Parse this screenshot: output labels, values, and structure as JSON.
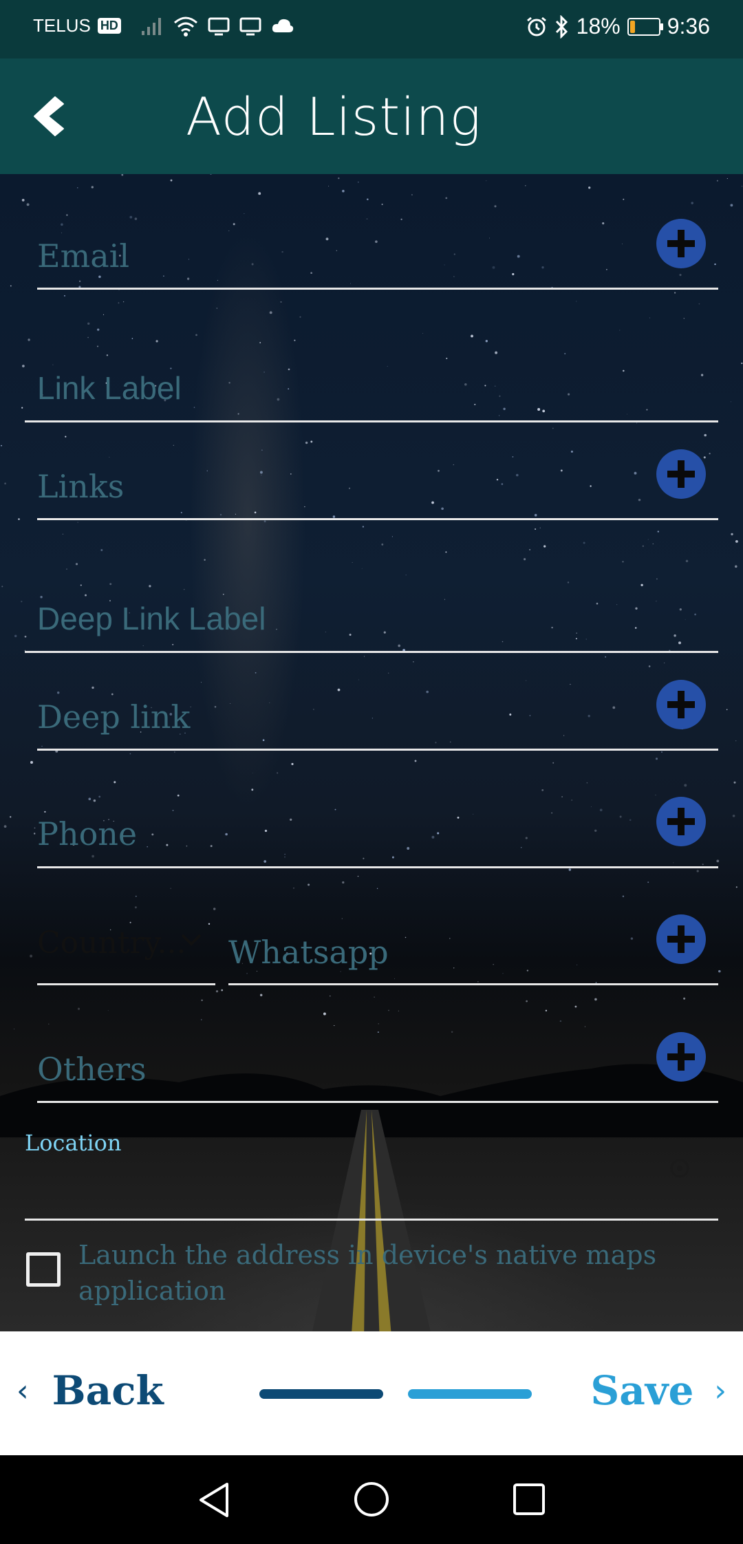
{
  "status_bar": {
    "carrier": "TELUS",
    "hd_badge": "HD",
    "battery_percent": "18%",
    "battery_level": 0.18,
    "time": "9:36",
    "icons": [
      "signal-icon",
      "wifi-icon",
      "cast-icon",
      "cast-icon",
      "cloud-icon",
      "alarm-icon",
      "bluetooth-icon",
      "battery-icon"
    ]
  },
  "header": {
    "title": "Add Listing",
    "back_icon": "chevron-left-icon"
  },
  "form": {
    "email_placeholder": "Email",
    "link_label_placeholder": "Link Label",
    "links_placeholder": "Links",
    "deep_link_label_placeholder": "Deep Link Label",
    "deep_link_placeholder": "Deep link",
    "phone_placeholder": "Phone",
    "country_placeholder": "Country...",
    "whatsapp_placeholder": "Whatsapp",
    "others_placeholder": "Others",
    "location_label": "Location",
    "location_value": "",
    "launch_maps_label": "Launch the address in device's native maps application",
    "launch_maps_checked": false
  },
  "footer": {
    "back_label": "Back",
    "save_label": "Save",
    "steps_total": 2,
    "current_step": 2
  },
  "colors": {
    "header_bg": "#0d4a4c",
    "status_bg": "#0a3a3c",
    "plus_button": "#2650a8",
    "back_text": "#0d4a75",
    "save_text": "#2a9fd6",
    "location_label": "#7fd4f5"
  }
}
